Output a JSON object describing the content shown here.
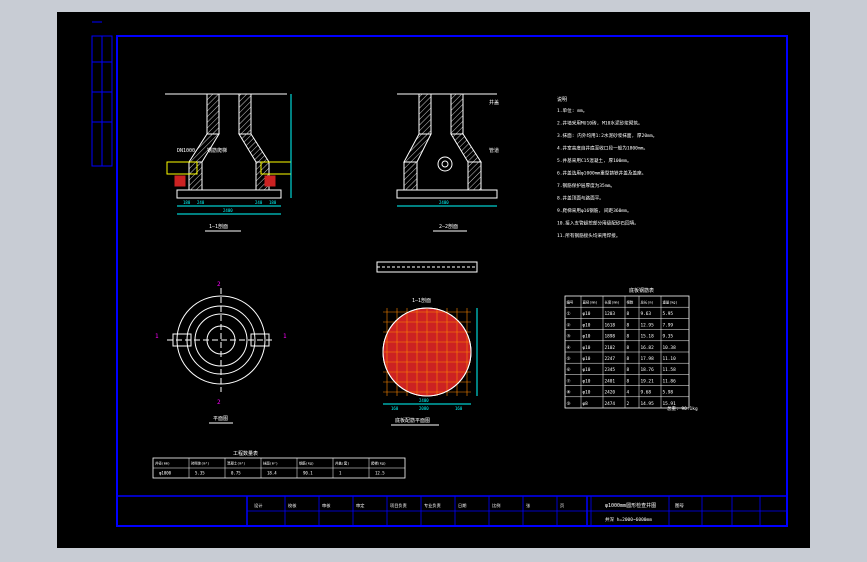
{
  "viewport": {
    "background": "#000000",
    "frame_color": "#0000ff"
  },
  "colors": {
    "line": "#ffffff",
    "dim": "#00ffff",
    "accent": "#ff00ff",
    "fill": "#cc2222",
    "grid": "#ff8800",
    "text": "#ffffff"
  },
  "section_a": {
    "title": "1—1剖面",
    "label_pipe": "DN1000",
    "label_ladder": "钢筋爬梯",
    "dims": [
      "180",
      "240",
      "2400",
      "240",
      "180"
    ]
  },
  "section_b": {
    "title": "2—2剖面",
    "label_cover": "井盖",
    "label_pipe": "管道",
    "dims": [
      "2400"
    ]
  },
  "plan": {
    "title": "平面图",
    "marks": [
      "1",
      "1",
      "2",
      "2"
    ]
  },
  "rebar_plan": {
    "title": "底板配筋平面图",
    "section_title": "1—1剖面",
    "dims": [
      "2400",
      "160",
      "2080",
      "160"
    ]
  },
  "notes": {
    "heading": "说明",
    "items": [
      "1.单位: mm。",
      "2.井墙采用MU10砖, M10水泥砂浆砌筑。",
      "3.抹面: 内外均用1:2水泥砂浆抹面, 厚20mm。",
      "4.井室高度自井底至收口段一般为1800mm。",
      "5.井基采用C15混凝土, 厚100mm。",
      "6.井盖选用φ1000mm重型铸铁井盖及盖座。",
      "7.钢筋保护层厚度为35mm。",
      "8.井盖顶面与路面平。",
      "9.爬梯采用φ16钢筋, 间距360mm。",
      "10.接入支管超挖部分用级配砂石回填。",
      "11.所有钢筋接头均采用焊接。"
    ]
  },
  "rebar_table": {
    "title": "底板钢筋表",
    "headers": [
      "编号",
      "直径(mm)",
      "长度(mm)",
      "根数",
      "总长(m)",
      "重量(kg)"
    ],
    "rows": [
      [
        "①",
        "φ10",
        "1203",
        "8",
        "9.63",
        "5.95"
      ],
      [
        "②",
        "φ10",
        "1618",
        "8",
        "12.95",
        "7.99"
      ],
      [
        "③",
        "φ10",
        "1898",
        "8",
        "15.18",
        "9.35"
      ],
      [
        "④",
        "φ10",
        "2102",
        "8",
        "16.82",
        "10.38"
      ],
      [
        "⑤",
        "φ10",
        "2247",
        "8",
        "17.98",
        "11.10"
      ],
      [
        "⑥",
        "φ10",
        "2345",
        "8",
        "18.76",
        "11.58"
      ],
      [
        "⑦",
        "φ10",
        "2401",
        "8",
        "19.21",
        "11.86"
      ],
      [
        "⑧",
        "φ10",
        "2420",
        "4",
        "9.68",
        "5.98"
      ],
      [
        "⑨",
        "φ8",
        "2474",
        "2",
        "14.95",
        "15.91"
      ]
    ],
    "total": "总重: 90.1kg"
  },
  "quantity_table": {
    "title": "工程数量表",
    "headers": [
      "井径(mm)",
      "砖砌体(m³)",
      "混凝土(m³)",
      "抹面(m²)",
      "钢筋(kg)",
      "井盖(套)",
      "爬梯(kg)"
    ],
    "row": [
      "φ1000",
      "5.35",
      "0.75",
      "18.4",
      "90.1",
      "1",
      "12.5"
    ]
  },
  "title_block": {
    "drawing_title": "φ1000mm圆形检查井图",
    "drawing_sub": "井深 h=2000~6000mm",
    "drawing_no": "图号",
    "small_labels": [
      "设计",
      "校核",
      "审核",
      "审定",
      "项目负责",
      "专业负责",
      "日期",
      "比例",
      "张",
      "页"
    ]
  }
}
